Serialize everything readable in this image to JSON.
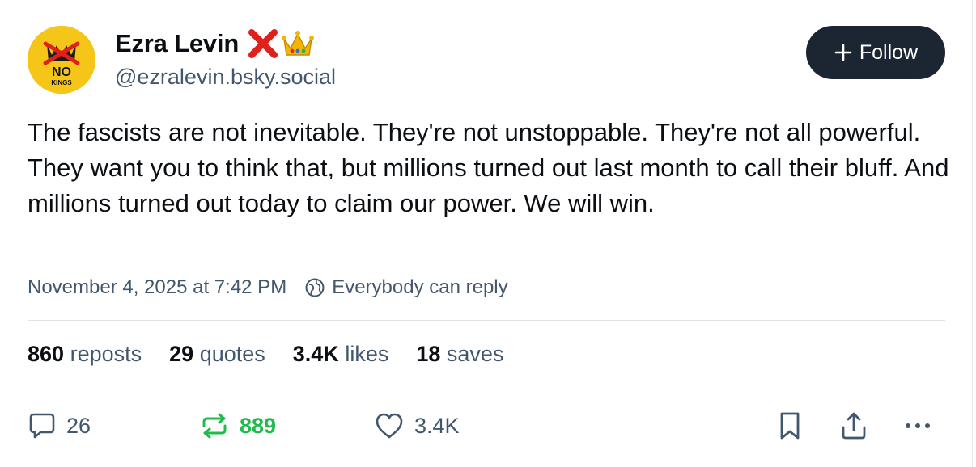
{
  "author": {
    "display_name": "Ezra Levin",
    "handle": "@ezralevin.bsky.social",
    "avatar_text_top": "NO",
    "avatar_text_bottom": "KINGS",
    "badges": [
      "red-x-icon",
      "crown-icon"
    ]
  },
  "follow_button": {
    "label": "Follow",
    "icon": "plus-icon"
  },
  "post": {
    "text": "The fascists are not inevitable. They're not unstoppable. They're not all powerful. They want you to think that, but millions turned out last month to call their bluff. And millions turned out today to claim our power. We will win.",
    "timestamp": "November 4, 2025 at 7:42 PM",
    "reply_setting": "Everybody can reply"
  },
  "stats": {
    "reposts": {
      "count": "860",
      "label": "reposts"
    },
    "quotes": {
      "count": "29",
      "label": "quotes"
    },
    "likes": {
      "count": "3.4K",
      "label": "likes"
    },
    "saves": {
      "count": "18",
      "label": "saves"
    }
  },
  "actions": {
    "reply_count": "26",
    "repost_count": "889",
    "like_count": "3.4K"
  },
  "colors": {
    "text_primary": "#0b0f14",
    "text_secondary": "#42576c",
    "follow_bg": "#1c2633",
    "repost_active": "#20bc4b",
    "avatar_bg": "#f5c518",
    "badge_red": "#e0201b"
  }
}
